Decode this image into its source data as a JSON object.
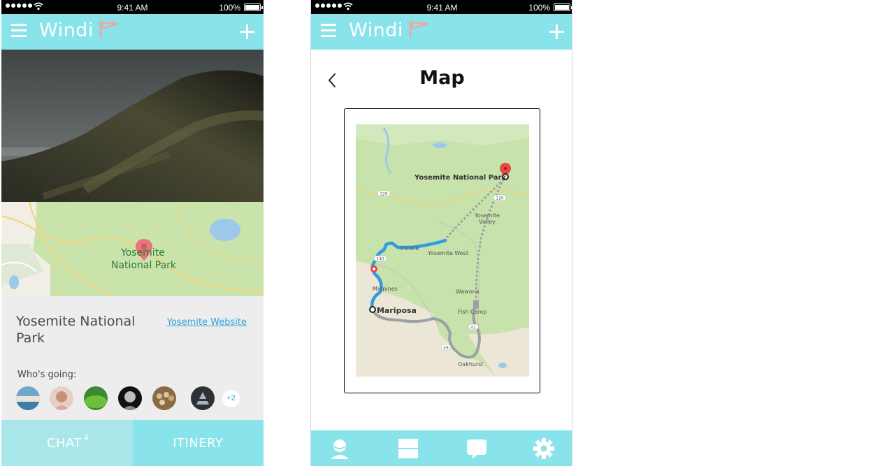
{
  "status_bar": {
    "time": "9:41 AM",
    "battery": "100%"
  },
  "app": {
    "name": "Windi"
  },
  "detail": {
    "map_label_line1": "Yosemite",
    "map_label_line2": "National Park",
    "park_name": "Yosemite National Park",
    "website_link": "Yosemite Website",
    "whos_going_label": "Who's going:",
    "more_count": "+2",
    "tabs": {
      "chat": "CHAT",
      "chat_badge": "4",
      "itinery": "ITINERY"
    }
  },
  "map_screen": {
    "title": "Map",
    "labels": {
      "park": "Yosemite National Park",
      "yosemite_valley_1": "Yosemite",
      "yosemite_valley_2": "Valley",
      "yosemite_west": "Yosemite West",
      "incline": "Incline",
      "midpines": "Midpines",
      "mariposa": "Mariposa",
      "wawona": "Wawona",
      "fish_camp": "Fish Camp",
      "oakhurst": "Oakhurst",
      "route_120a": "120",
      "route_120b": "120",
      "route_140": "140",
      "route_49": "49",
      "route_41": "41"
    }
  },
  "colors": {
    "accent": "#88e3ea",
    "tab_active": "#a8e6ea",
    "link": "#3aa0d8",
    "map_green": "#c8e3a8",
    "pin": "#e8737a"
  }
}
